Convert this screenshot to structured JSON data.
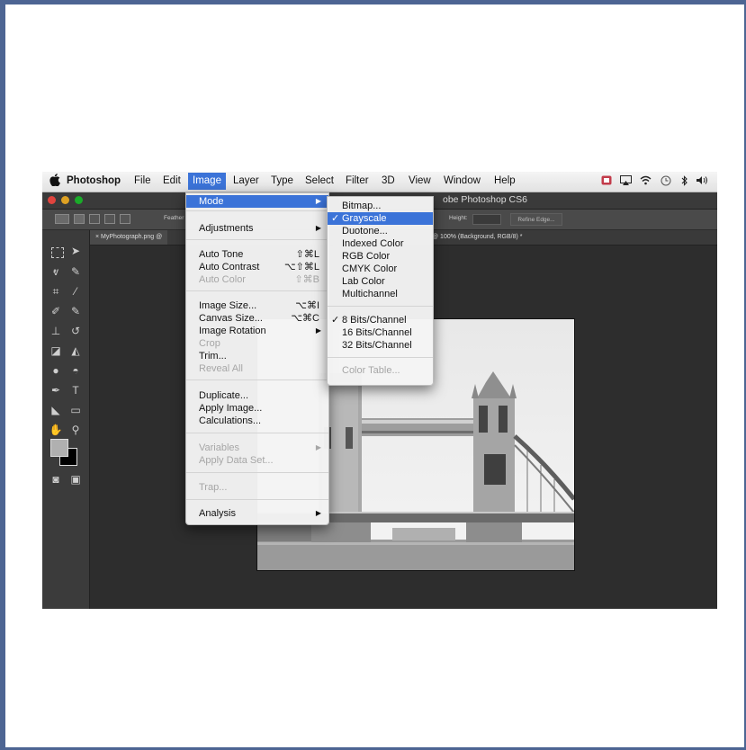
{
  "menubar": {
    "app": "Photoshop",
    "items": [
      "File",
      "Edit",
      "Image",
      "Layer",
      "Type",
      "Select",
      "Filter",
      "3D",
      "View",
      "Window",
      "Help"
    ]
  },
  "window": {
    "title": "Adobe Photoshop CS6",
    "title_visible": "obe Photoshop CS6",
    "doc_tab_label": "MyPhotograph.png @",
    "doc_tab_status": "@ 100% (Background, RGB/8) *"
  },
  "options": {
    "feather_label": "Feather",
    "height_label": "Height:",
    "refine_label": "Refine Edge..."
  },
  "image_menu": {
    "items": [
      {
        "label": "Mode",
        "shortcut": "",
        "submenu": true,
        "disabled": false,
        "highlighted": true
      },
      {
        "label": "Adjustments",
        "shortcut": "",
        "submenu": true,
        "disabled": false
      },
      {
        "label": "Auto Tone",
        "shortcut": "⇧⌘L",
        "disabled": false
      },
      {
        "label": "Auto Contrast",
        "shortcut": "⌥⇧⌘L",
        "disabled": false
      },
      {
        "label": "Auto Color",
        "shortcut": "⇧⌘B",
        "disabled": true
      },
      {
        "label": "Image Size...",
        "shortcut": "⌥⌘I",
        "disabled": false
      },
      {
        "label": "Canvas Size...",
        "shortcut": "⌥⌘C",
        "disabled": false
      },
      {
        "label": "Image Rotation",
        "shortcut": "",
        "submenu": true,
        "disabled": false
      },
      {
        "label": "Crop",
        "shortcut": "",
        "disabled": true
      },
      {
        "label": "Trim...",
        "shortcut": "",
        "disabled": false
      },
      {
        "label": "Reveal All",
        "shortcut": "",
        "disabled": true
      },
      {
        "label": "Duplicate...",
        "shortcut": "",
        "disabled": false
      },
      {
        "label": "Apply Image...",
        "shortcut": "",
        "disabled": false
      },
      {
        "label": "Calculations...",
        "shortcut": "",
        "disabled": false
      },
      {
        "label": "Variables",
        "shortcut": "",
        "submenu": true,
        "disabled": true
      },
      {
        "label": "Apply Data Set...",
        "shortcut": "",
        "disabled": true
      },
      {
        "label": "Trap...",
        "shortcut": "",
        "disabled": true
      },
      {
        "label": "Analysis",
        "shortcut": "",
        "submenu": true,
        "disabled": false
      }
    ]
  },
  "mode_menu": {
    "items": [
      {
        "label": "Bitmap...",
        "checked": false,
        "highlighted": false,
        "disabled": false
      },
      {
        "label": "Grayscale",
        "checked": true,
        "highlighted": true,
        "disabled": false
      },
      {
        "label": "Duotone...",
        "checked": false,
        "highlighted": false,
        "disabled": false
      },
      {
        "label": "Indexed Color",
        "checked": false,
        "highlighted": false,
        "disabled": false
      },
      {
        "label": "RGB Color",
        "checked": false,
        "highlighted": false,
        "disabled": false
      },
      {
        "label": "CMYK Color",
        "checked": false,
        "highlighted": false,
        "disabled": false
      },
      {
        "label": "Lab Color",
        "checked": false,
        "highlighted": false,
        "disabled": false
      },
      {
        "label": "Multichannel",
        "checked": false,
        "highlighted": false,
        "disabled": false
      },
      {
        "label": "8 Bits/Channel",
        "checked": true,
        "highlighted": false,
        "disabled": false
      },
      {
        "label": "16 Bits/Channel",
        "checked": false,
        "highlighted": false,
        "disabled": false
      },
      {
        "label": "32 Bits/Channel",
        "checked": false,
        "highlighted": false,
        "disabled": false
      },
      {
        "label": "Color Table...",
        "checked": false,
        "highlighted": false,
        "disabled": true
      }
    ],
    "check_mark": "✓"
  },
  "colors": {
    "frame": "#4d6593",
    "highlight": "#3b73d8",
    "workspace": "#2d2d2d"
  },
  "icons": [
    "apple-icon",
    "adobe-icon",
    "airplay-icon",
    "wifi-icon",
    "time-machine-icon",
    "bluetooth-icon",
    "volume-icon"
  ]
}
